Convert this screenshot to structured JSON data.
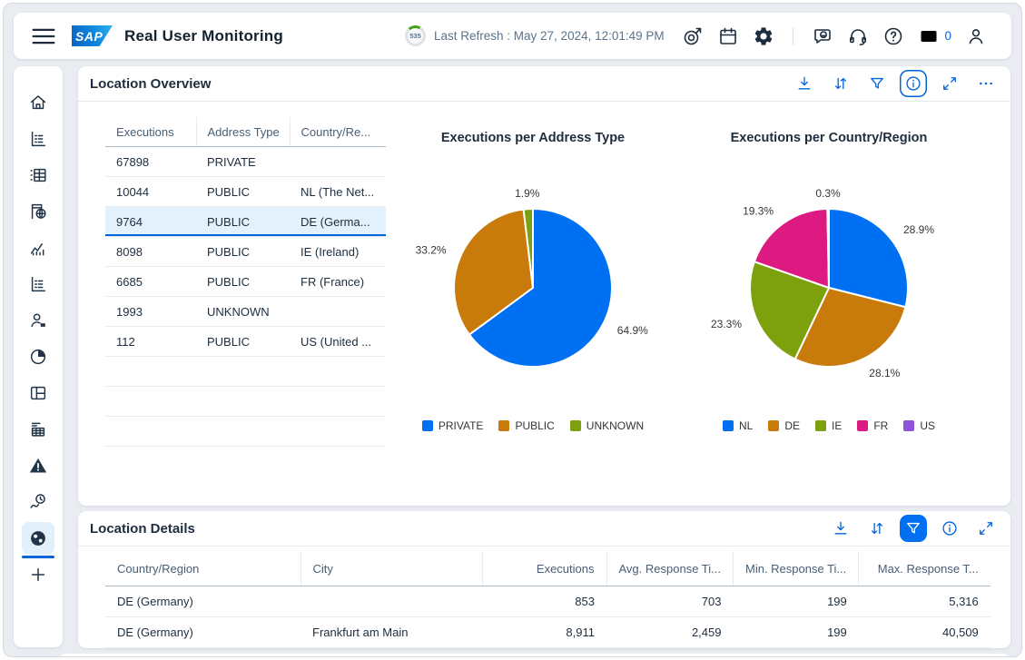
{
  "header": {
    "logo_text": "SAP",
    "app_title": "Real User Monitoring",
    "refresh_countdown": "535",
    "last_refresh": "Last Refresh : May 27, 2024, 12:01:49 PM",
    "notifications_count": "0",
    "left_icons": [
      {
        "id": "menu",
        "icon": "menu"
      }
    ],
    "right_icons": [
      {
        "id": "goal",
        "icon": "target"
      },
      {
        "id": "schedule",
        "icon": "calendar"
      },
      {
        "id": "settings",
        "icon": "gear"
      },
      {
        "id": "divider",
        "icon": "divider"
      },
      {
        "id": "feedback",
        "icon": "feedback"
      },
      {
        "id": "support",
        "icon": "headset"
      },
      {
        "id": "help",
        "icon": "help"
      },
      {
        "id": "notifications",
        "icon": "message"
      },
      {
        "id": "profile",
        "icon": "person"
      }
    ]
  },
  "sidebar": {
    "items": [
      {
        "id": "home",
        "icon": "home"
      },
      {
        "id": "report-chart",
        "icon": "chart-list"
      },
      {
        "id": "data-table",
        "icon": "grid-table"
      },
      {
        "id": "web-globe-pages",
        "icon": "page-globe"
      },
      {
        "id": "performance-trend",
        "icon": "trend"
      },
      {
        "id": "report-chart-2",
        "icon": "chart-list"
      },
      {
        "id": "users",
        "icon": "user-badge"
      },
      {
        "id": "time-distribution",
        "icon": "pie-clock"
      },
      {
        "id": "dashboard-layout",
        "icon": "layout"
      },
      {
        "id": "request-table",
        "icon": "list-table"
      },
      {
        "id": "alerts",
        "icon": "warning"
      },
      {
        "id": "response-times",
        "icon": "clock-wave"
      },
      {
        "id": "locations",
        "icon": "globe",
        "selected": true
      },
      {
        "id": "add",
        "icon": "plus"
      }
    ]
  },
  "overview": {
    "title": "Location Overview",
    "toolbar": [
      {
        "id": "download",
        "icon": "download"
      },
      {
        "id": "sort",
        "icon": "sort"
      },
      {
        "id": "filter",
        "icon": "filter"
      },
      {
        "id": "info",
        "icon": "info",
        "focused": true
      },
      {
        "id": "expand",
        "icon": "expand"
      },
      {
        "id": "overflow",
        "icon": "ellipsis"
      }
    ],
    "table": {
      "columns": [
        "Executions",
        "Address Type",
        "Country/Re..."
      ],
      "rows": [
        [
          "67898",
          "PRIVATE",
          ""
        ],
        [
          "10044",
          "PUBLIC",
          "NL (The Net..."
        ],
        [
          "9764",
          "PUBLIC",
          "DE (Germa..."
        ],
        [
          "8098",
          "PUBLIC",
          "IE (Ireland)"
        ],
        [
          "6685",
          "PUBLIC",
          "FR (France)"
        ],
        [
          "1993",
          "UNKNOWN",
          ""
        ],
        [
          "112",
          "PUBLIC",
          "US (United ..."
        ]
      ],
      "selected_row_index": 2,
      "filler_rows": 3
    }
  },
  "details": {
    "title": "Location Details",
    "toolbar": [
      {
        "id": "download",
        "icon": "download"
      },
      {
        "id": "sort",
        "icon": "sort"
      },
      {
        "id": "filter",
        "icon": "filter",
        "active": true
      },
      {
        "id": "info",
        "icon": "info"
      },
      {
        "id": "expand",
        "icon": "expand"
      }
    ],
    "table": {
      "columns": [
        {
          "label": "Country/Region",
          "align": "left"
        },
        {
          "label": "City",
          "align": "left"
        },
        {
          "label": "Executions",
          "align": "right"
        },
        {
          "label": "Avg. Response Ti...",
          "align": "right"
        },
        {
          "label": "Min. Response Ti...",
          "align": "right"
        },
        {
          "label": "Max. Response T...",
          "align": "right"
        }
      ],
      "rows": [
        [
          "DE (Germany)",
          "",
          "853",
          "703",
          "199",
          "5,316"
        ],
        [
          "DE (Germany)",
          "Frankfurt am Main",
          "8,911",
          "2,459",
          "199",
          "40,509"
        ]
      ]
    }
  },
  "chart_data": [
    {
      "type": "pie",
      "title": "Executions per Address Type",
      "labels": [
        "PRIVATE",
        "PUBLIC",
        "UNKNOWN"
      ],
      "values": [
        64.9,
        33.2,
        1.9
      ],
      "value_labels": [
        "64.9%",
        "33.2%",
        "1.9%"
      ],
      "colors": [
        "#0070f2",
        "#c87b0a",
        "#7ca10c"
      ],
      "legend_position": "bottom"
    },
    {
      "type": "pie",
      "title": "Executions per Country/Region",
      "labels": [
        "NL",
        "DE",
        "IE",
        "FR",
        "US"
      ],
      "values": [
        28.9,
        28.1,
        23.3,
        19.3,
        0.3
      ],
      "value_labels": [
        "28.9%",
        "28.1%",
        "23.3%",
        "19.3%",
        "0.3%"
      ],
      "colors": [
        "#0070f2",
        "#c87b0a",
        "#7ca10c",
        "#dc1a82",
        "#8e54d9"
      ],
      "legend_position": "bottom"
    }
  ],
  "colors": {
    "accent_blue": "#0070f2",
    "toolbar_blue": "#0064d9",
    "selected_row_bg": "#e3f1fc",
    "page_bg": "#e9edf2"
  }
}
